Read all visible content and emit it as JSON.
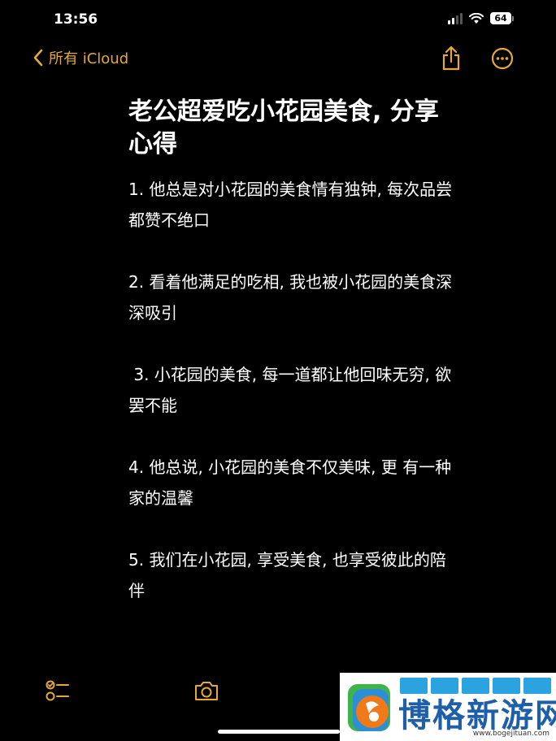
{
  "status_bar": {
    "time": "13:56",
    "battery": "64"
  },
  "nav": {
    "back_label": "所有 iCloud",
    "icons": {
      "back": "chevron-left-icon",
      "share": "share-icon",
      "more": "more-circle-icon"
    }
  },
  "note": {
    "title": "老公超爱吃小花园美食, 分享心得",
    "items": [
      "1. 他总是对小花园的美食情有独钟, 每次品尝都赞不绝口",
      "2. 看着他满足的吃相, 我也被小花园的美食深深吸引",
      " 3. 小花园的美食, 每一道都让他回味无穷, 欲罢不能",
      "4. 他总说, 小花园的美食不仅美味, 更 有一种家的温馨",
      "5. 我们在小花园, 享受美食, 也享受彼此的陪伴"
    ]
  },
  "toolbar": {
    "icons": {
      "checklist": "checklist-icon",
      "camera": "camera-icon"
    }
  },
  "watermark": {
    "name": "博格新游网",
    "url": "www.bogejituan.com"
  },
  "colors": {
    "background": "#000000",
    "text": "#ffffff",
    "accent": "#e5a93a"
  }
}
